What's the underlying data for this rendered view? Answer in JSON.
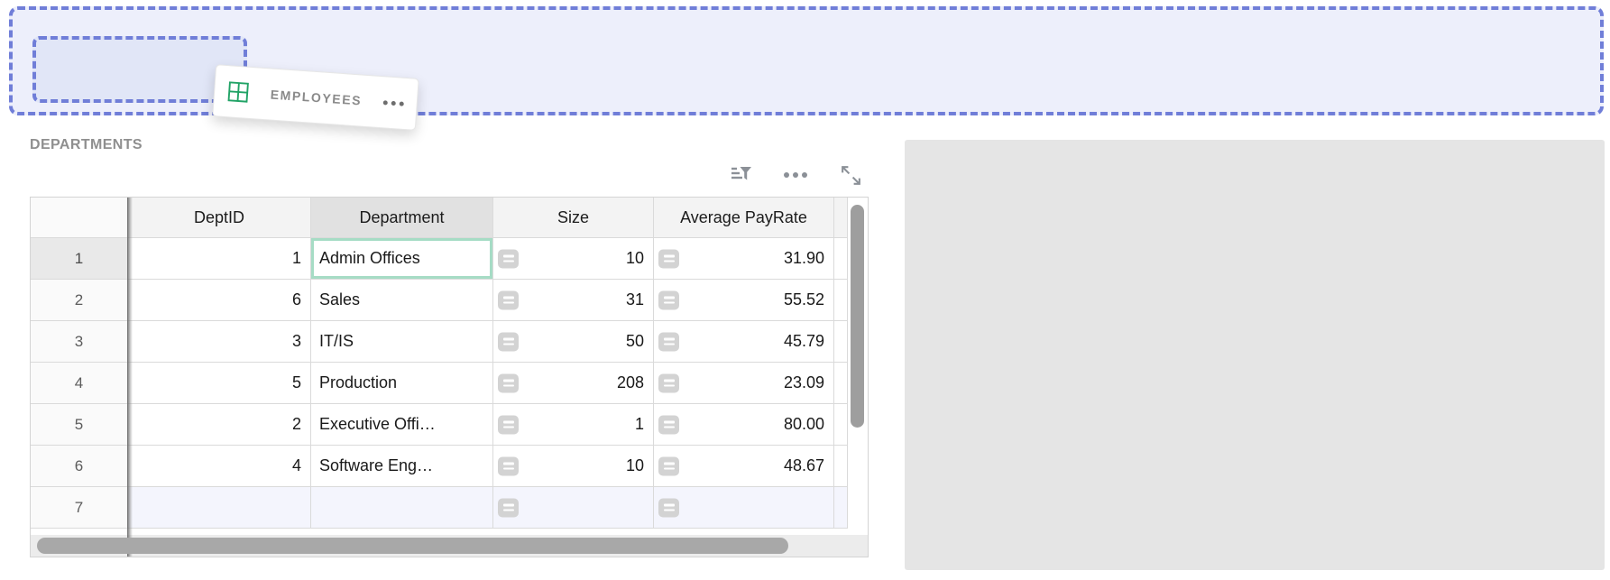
{
  "drop_zone": {
    "border_color": "#707ed8",
    "outer_fill": "#edeffb",
    "inner_fill": "#e1e6f7"
  },
  "drag_card": {
    "label": "EMPLOYEES",
    "icon": "table-grid-icon",
    "icon_color": "#21a366"
  },
  "sheet": {
    "title": "DEPARTMENTS",
    "toolbar": {
      "icons": [
        "sort-filter",
        "more",
        "expand"
      ],
      "icon_color": "#8b9097"
    },
    "selection": {
      "selected_cell": "row 1 / Department",
      "selection_border_color": "#a6dcc5"
    },
    "table": {
      "headers": {
        "dept_id": "DeptID",
        "department": "Department",
        "size": "Size",
        "pay_rate": "Average PayRate"
      },
      "rows": [
        {
          "num": "1",
          "dept_id": "1",
          "department": "Admin Offices",
          "size": "10",
          "pay_rate": "31.90"
        },
        {
          "num": "2",
          "dept_id": "6",
          "department": "Sales",
          "size": "31",
          "pay_rate": "55.52"
        },
        {
          "num": "3",
          "dept_id": "3",
          "department": "IT/IS",
          "size": "50",
          "pay_rate": "45.79"
        },
        {
          "num": "4",
          "dept_id": "5",
          "department": "Production",
          "size": "208",
          "pay_rate": "23.09"
        },
        {
          "num": "5",
          "dept_id": "2",
          "department": "Executive Offi…",
          "size": "1",
          "pay_rate": "80.00"
        },
        {
          "num": "6",
          "dept_id": "4",
          "department": "Software Eng…",
          "size": "10",
          "pay_rate": "48.67"
        },
        {
          "num": "7",
          "dept_id": "",
          "department": "",
          "size": "",
          "pay_rate": ""
        }
      ]
    }
  },
  "side_panel": {
    "fill": "#e5e5e5"
  }
}
